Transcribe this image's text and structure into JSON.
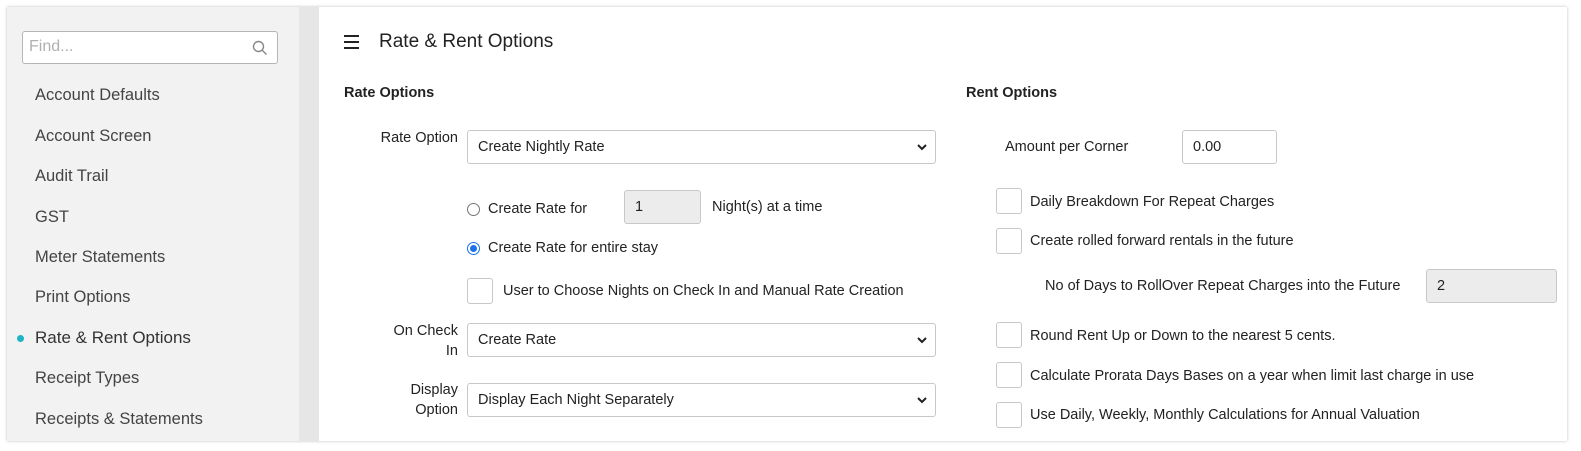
{
  "sidebar": {
    "search_placeholder": "Find...",
    "search_icon": "search-icon",
    "items": [
      {
        "label": "Account Defaults"
      },
      {
        "label": "Account Screen"
      },
      {
        "label": "Audit Trail"
      },
      {
        "label": "GST"
      },
      {
        "label": "Meter Statements"
      },
      {
        "label": "Print Options"
      },
      {
        "label": "Rate & Rent Options",
        "active": true
      },
      {
        "label": "Receipt Types"
      },
      {
        "label": "Receipts & Statements"
      }
    ],
    "active_color": "#1fb3c4"
  },
  "header": {
    "menu_icon": "hamburger-menu-icon",
    "title": "Rate & Rent Options"
  },
  "rate_options": {
    "heading": "Rate Options",
    "rate_option_label": "Rate Option",
    "rate_option_value": "Create Nightly Rate",
    "radio_create_rate_for_label": "Create Rate for",
    "nights_value": "1",
    "nights_suffix": "Night(s) at a time",
    "radio_entire_stay_label": "Create Rate for entire stay",
    "selected_radio": "entire_stay",
    "user_choose_nights_label": "User to Choose Nights on Check In and Manual Rate Creation",
    "on_check_in_label": "On Check In",
    "on_check_in_value": "Create Rate",
    "display_option_label": "Display Option",
    "display_option_value": "Display Each Night Separately"
  },
  "rent_options": {
    "heading": "Rent Options",
    "amount_per_corner_label": "Amount per Corner",
    "amount_per_corner_value": "0.00",
    "daily_breakdown_label": "Daily Breakdown For Repeat Charges",
    "rolled_forward_label": "Create rolled forward rentals in the future",
    "rollover_days_label": "No of Days to RollOver Repeat Charges into the Future",
    "rollover_days_value": "2",
    "round_rent_label": "Round Rent Up or Down to the nearest 5 cents.",
    "prorata_label": "Calculate Prorata Days Bases on a year when limit last charge in use",
    "annual_valuation_label": "Use Daily, Weekly, Monthly Calculations for Annual Valuation"
  },
  "colors": {
    "accent": "#1a73e8",
    "sidebar_bg": "#f2f2f2"
  }
}
